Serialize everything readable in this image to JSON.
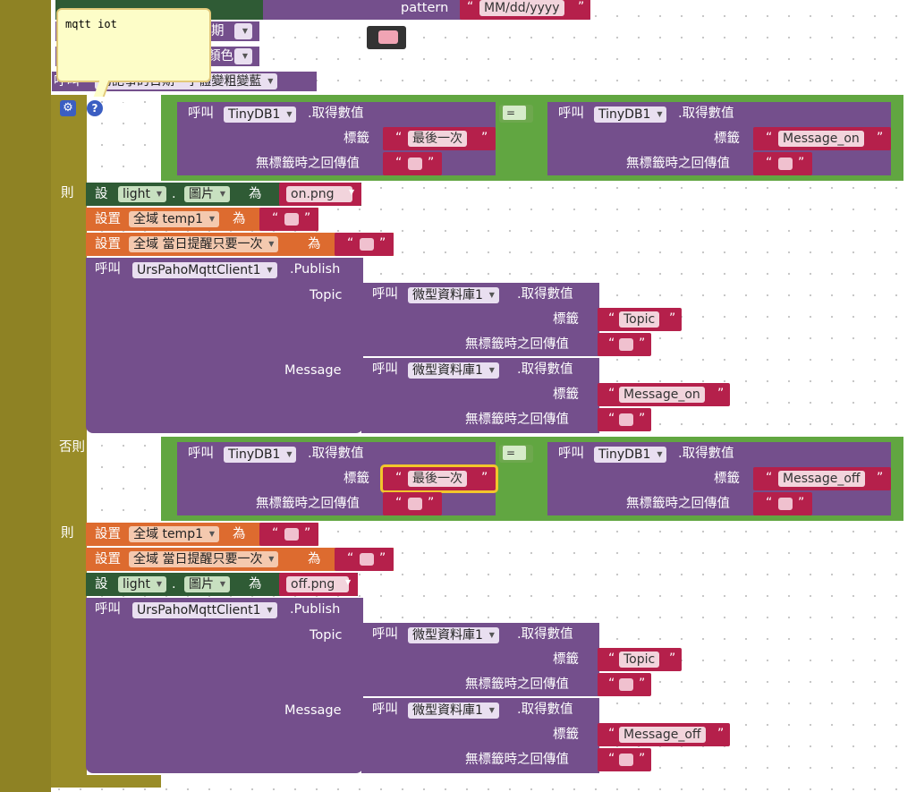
{
  "colors": {
    "control": "#998c28",
    "procedure": "#744f8c",
    "logic": "#61a641",
    "component": "#2f5b35",
    "variable": "#dd6b2f",
    "text": "#b5204b"
  },
  "top": {
    "pattern_label": "pattern",
    "pattern_value": "MM/dd/yyyy",
    "partial1": "期",
    "partial2": "顏色",
    "partial3_left": "呼叫",
    "partial3": "的記事的日期 · 字體變粗變藍"
  },
  "comment": {
    "text": "mqtt iot"
  },
  "if_block": {
    "if_label": "如果",
    "then_label": "則",
    "else_label": "否則，如果",
    "then2_label": "則"
  },
  "cond1": {
    "call": "呼叫",
    "db": "TinyDB1",
    "method": ".取得數值",
    "tag_label": "標籤",
    "tag": "最後一次",
    "default_label": "無標籤時之回傳值",
    "op": "=",
    "call2": "呼叫",
    "db2": "TinyDB1",
    "method2": ".取得數值",
    "tag_label2": "標籤",
    "tag2": "Message_on",
    "default_label2": "無標籤時之回傳值"
  },
  "then1": {
    "set_label": "設",
    "component": "light",
    "dot": ".",
    "property": "圖片",
    "to": "為",
    "image": "on.png",
    "set2": "設置",
    "var1": "全域 temp1",
    "to2": "為",
    "set3": "設置",
    "var2": "全域 當日提醒只要一次",
    "to3": "為",
    "call": "呼叫",
    "client": "UrsPahoMqttClient1",
    "publish": ".Publish",
    "topic_label": "Topic",
    "message_label": "Message",
    "tcall": "呼叫",
    "tdb": "微型資料庫1",
    "tmethod": ".取得數值",
    "ttag_label": "標籤",
    "ttag": "Topic",
    "tdefault": "無標籤時之回傳值",
    "mcall": "呼叫",
    "mdb": "微型資料庫1",
    "mmethod": ".取得數值",
    "mtag_label": "標籤",
    "mtag": "Message_on",
    "mdefault": "無標籤時之回傳值"
  },
  "cond2": {
    "call": "呼叫",
    "db": "TinyDB1",
    "method": ".取得數值",
    "tag_label": "標籤",
    "tag": "最後一次",
    "default_label": "無標籤時之回傳值",
    "op": "=",
    "call2": "呼叫",
    "db2": "TinyDB1",
    "method2": ".取得數值",
    "tag_label2": "標籤",
    "tag2": "Message_off",
    "default_label2": "無標籤時之回傳值"
  },
  "then2": {
    "set2": "設置",
    "var1": "全域 temp1",
    "to2": "為",
    "set3": "設置",
    "var2": "全域 當日提醒只要一次",
    "to3": "為",
    "set_label": "設",
    "component": "light",
    "dot": ".",
    "property": "圖片",
    "to": "為",
    "image": "off.png",
    "call": "呼叫",
    "client": "UrsPahoMqttClient1",
    "publish": ".Publish",
    "topic_label": "Topic",
    "message_label": "Message",
    "tcall": "呼叫",
    "tdb": "微型資料庫1",
    "tmethod": ".取得數值",
    "ttag_label": "標籤",
    "ttag": "Topic",
    "tdefault": "無標籤時之回傳值",
    "mcall": "呼叫",
    "mdb": "微型資料庫1",
    "mmethod": ".取得數值",
    "mtag_label": "標籤",
    "mtag": "Message_off",
    "mdefault": "無標籤時之回傳值"
  }
}
